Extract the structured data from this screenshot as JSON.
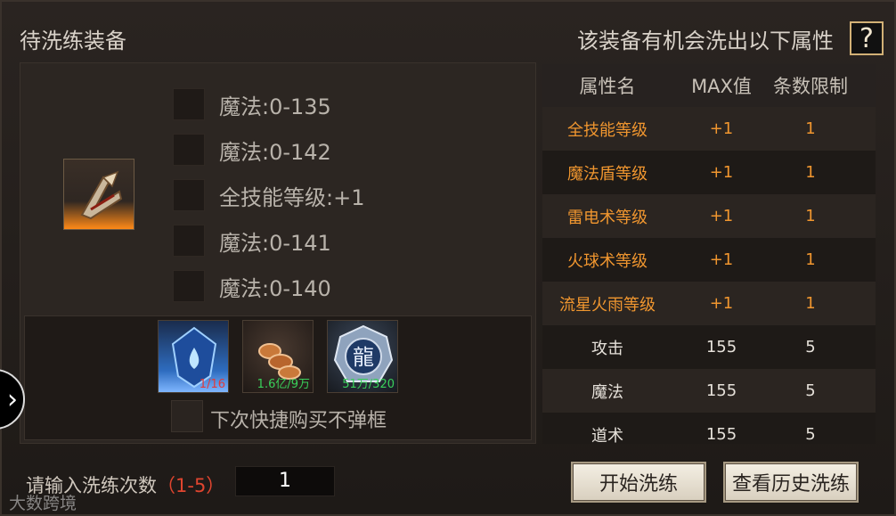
{
  "header": {
    "left_title": "待洗练装备",
    "right_title": "该装备有机会洗出以下属性",
    "help_label": "?"
  },
  "attributes": [
    {
      "label": "魔法:0-135"
    },
    {
      "label": "魔法:0-142"
    },
    {
      "label": "全技能等级:+1"
    },
    {
      "label": "魔法:0-141"
    },
    {
      "label": "魔法:0-140"
    }
  ],
  "materials": [
    {
      "name": "blue-crystal-icon",
      "count": "1/16",
      "count_color": "#e03a3a"
    },
    {
      "name": "coins-icon",
      "count": "1.6亿/9万",
      "count_color": "#39d05a"
    },
    {
      "name": "dragon-badge-icon",
      "count": "51万/320",
      "count_color": "#39d05a"
    }
  ],
  "no_popup_label": "下次快捷购买不弹框",
  "table": {
    "headers": [
      "属性名",
      "MAX值",
      "条数限制"
    ],
    "rows": [
      {
        "name": "全技能等级",
        "max": "+1",
        "limit": "1"
      },
      {
        "name": "魔法盾等级",
        "max": "+1",
        "limit": "1"
      },
      {
        "name": "雷电术等级",
        "max": "+1",
        "limit": "1"
      },
      {
        "name": "火球术等级",
        "max": "+1",
        "limit": "1"
      },
      {
        "name": "流星火雨等级",
        "max": "+1",
        "limit": "1"
      },
      {
        "name": "攻击",
        "max": "155",
        "limit": "5"
      },
      {
        "name": "魔法",
        "max": "155",
        "limit": "5"
      },
      {
        "name": "道术",
        "max": "155",
        "limit": "5"
      }
    ]
  },
  "footer": {
    "count_label": "请输入洗练次数",
    "count_range": "（1-5）",
    "count_value": "1",
    "start_button": "开始洗练",
    "history_button": "查看历史洗练"
  },
  "watermark": "大数跨境",
  "colors": {
    "accent_orange": "#f0962f",
    "green_count": "#39d05a",
    "red_count": "#e03a3a"
  }
}
